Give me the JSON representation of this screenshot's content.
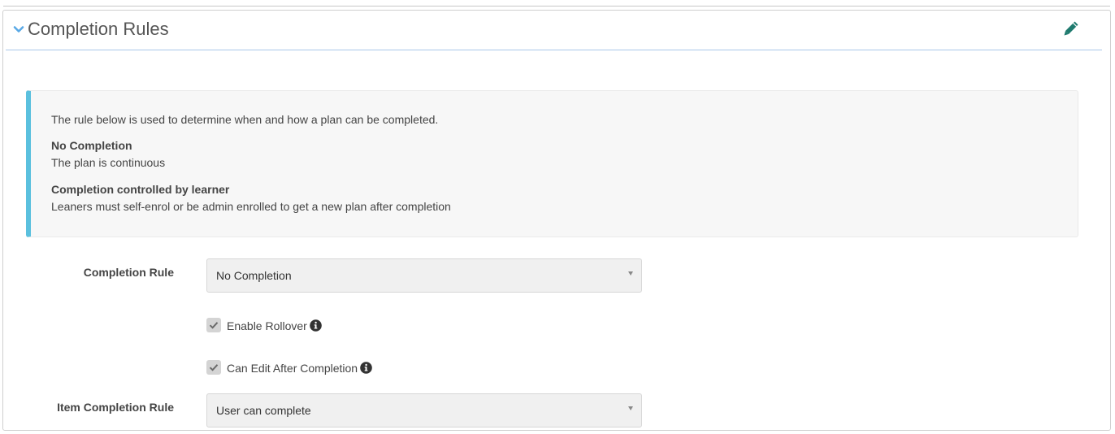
{
  "panel": {
    "title": "Completion Rules",
    "icons": {
      "collapse": "chevron-down-icon",
      "edit": "pencil-icon"
    },
    "colors": {
      "accent": "#5bc0de",
      "header_border": "#a9c7e8",
      "edit_icon": "#1e7a6e",
      "chevron": "#5aa9e6"
    }
  },
  "info": {
    "intro": "The rule below is used to determine when and how a plan can be completed.",
    "sections": [
      {
        "heading": "No Completion",
        "text": "The plan is continuous"
      },
      {
        "heading": "Completion controlled by learner",
        "text": "Leaners must self-enrol or be admin enrolled to get a new plan after completion"
      }
    ]
  },
  "form": {
    "completion_rule": {
      "label": "Completion Rule",
      "value": "No Completion"
    },
    "enable_rollover": {
      "label": "Enable Rollover",
      "checked": true
    },
    "can_edit_after_completion": {
      "label": "Can Edit After Completion",
      "checked": true
    },
    "item_completion_rule": {
      "label": "Item Completion Rule",
      "value": "User can complete"
    }
  }
}
